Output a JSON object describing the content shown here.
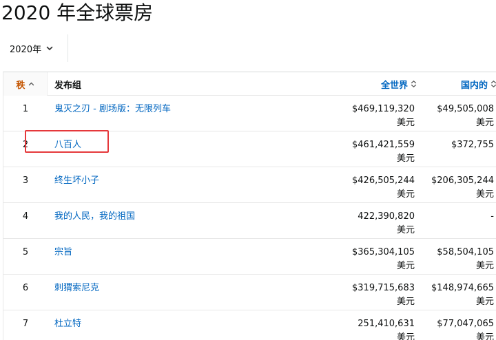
{
  "page": {
    "title": "2020 年全球票房"
  },
  "filter": {
    "year_label": "2020年"
  },
  "table": {
    "headers": {
      "rank": "秩",
      "release": "发布组",
      "worldwide": "全世界",
      "domestic": "国内的"
    },
    "rows": [
      {
        "rank": "1",
        "title": "鬼灭之刃 - 剧场版：无限列车",
        "worldwide": "$469,119,320",
        "worldwide_unit": "美元",
        "domestic": "$49,505,008",
        "domestic_unit": "美元"
      },
      {
        "rank": "2",
        "title": "八百人",
        "worldwide": "$461,421,559",
        "worldwide_unit": "美元",
        "domestic": "$372,755",
        "domestic_unit": ""
      },
      {
        "rank": "3",
        "title": "终生坏小子",
        "worldwide": "$426,505,244",
        "worldwide_unit": "美元",
        "domestic": "$206,305,244",
        "domestic_unit": "美元"
      },
      {
        "rank": "4",
        "title": "我的人民，我的祖国",
        "worldwide": "422,390,820",
        "worldwide_unit": "美元",
        "domestic": "-",
        "domestic_unit": ""
      },
      {
        "rank": "5",
        "title": "宗旨",
        "worldwide": "$365,304,105",
        "worldwide_unit": "美元",
        "domestic": "$58,504,105",
        "domestic_unit": "美元"
      },
      {
        "rank": "6",
        "title": "刺猬索尼克",
        "worldwide": "$319,715,683",
        "worldwide_unit": "美元",
        "domestic": "$148,974,665",
        "domestic_unit": "美元"
      },
      {
        "rank": "7",
        "title": "杜立特",
        "worldwide": "251,410,631",
        "worldwide_unit": "美元",
        "domestic": "$77,047,065",
        "domestic_unit": "美元"
      }
    ]
  },
  "colors": {
    "accent_link": "#0066c0",
    "rank_header": "#c45500",
    "highlight": "#e5383b"
  }
}
